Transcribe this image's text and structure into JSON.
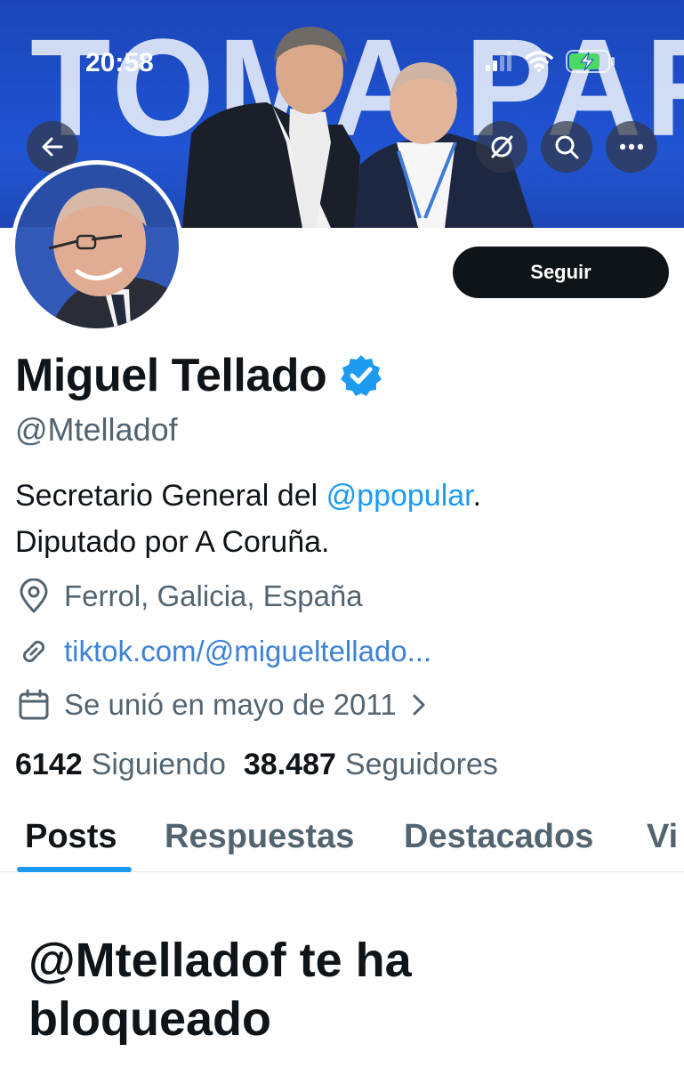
{
  "status_bar": {
    "time": "20:58"
  },
  "banner": {
    "text": "TOMA PARTIDO"
  },
  "header": {
    "follow_label": "Seguir"
  },
  "profile": {
    "name": "Miguel Tellado",
    "handle": "@Mtelladof",
    "bio_prefix": "Secretario General del ",
    "bio_mention": "@ppopular",
    "bio_suffix": ".",
    "bio_line2": "Diputado por A Coruña.",
    "location": "Ferrol, Galicia, España",
    "website": "tiktok.com/@migueltellado...",
    "joined": "Se unió en mayo de 2011",
    "following_count": "6142",
    "following_label": "Siguiendo",
    "followers_count": "38.487",
    "followers_label": "Seguidores"
  },
  "tabs": [
    {
      "label": "Posts"
    },
    {
      "label": "Respuestas"
    },
    {
      "label": "Destacados"
    },
    {
      "label": "Vi"
    }
  ],
  "blocked": {
    "message": "@Mtelladof te ha bloqueado"
  },
  "colors": {
    "accent": "#1d9bf0",
    "link": "#3d82d4",
    "verified": "#1d9bf0",
    "text_primary": "#0f1419",
    "text_secondary": "#536471",
    "banner": "#1f51cf"
  },
  "icons": [
    "back-arrow-icon",
    "grok-icon",
    "search-icon",
    "more-icon",
    "verified-badge-icon",
    "location-pin-icon",
    "link-icon",
    "calendar-icon",
    "chevron-right-icon",
    "signal-icon",
    "wifi-icon",
    "battery-icon"
  ]
}
